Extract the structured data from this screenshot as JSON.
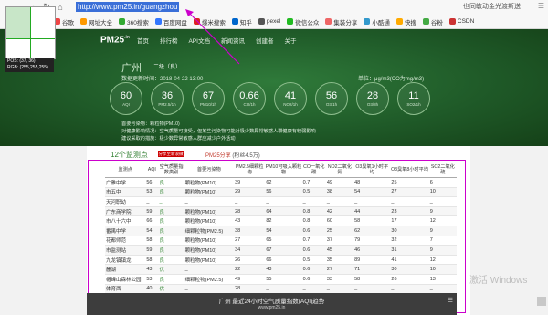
{
  "browser": {
    "url": "http://www.pm25.in/guangzhou",
    "toolbar_right": "也同敏动金光渡斯送",
    "bookmarks": [
      "谷歌",
      "网址大全",
      "360搜索",
      "百度网盘",
      "爆米搜索",
      "知乎",
      "pexel",
      "微信公众",
      "集装分享",
      "小酷通",
      "快搜",
      "谷粉",
      "CSDN"
    ]
  },
  "inspector": {
    "pos": "POS: (37, 36)",
    "rgb": "RGB: (255,255,255)"
  },
  "site": {
    "logo": "PM25",
    "logo_sup": ".in",
    "nav": [
      "首页",
      "排行榜",
      "API文档",
      "新闻资讯",
      "创建者",
      "关于"
    ]
  },
  "city": {
    "name": "广州",
    "level": "二级（良）",
    "updated": "数据更新时间：2018-04-22 13:00",
    "unit": "单位：μg/m3(CO为mg/m3)"
  },
  "metrics": [
    {
      "value": "60",
      "label": "AQI"
    },
    {
      "value": "36",
      "label": "PM2.5/1h"
    },
    {
      "value": "67",
      "label": "PM10/1h"
    },
    {
      "value": "0.66",
      "label": "CO/1h"
    },
    {
      "value": "41",
      "label": "NO2/1h"
    },
    {
      "value": "56",
      "label": "O3/1h"
    },
    {
      "value": "28",
      "label": "O3/8h"
    },
    {
      "value": "11",
      "label": "SO2/1h"
    }
  ],
  "info": {
    "primary": "首要污染物：颗粒物(PM10)",
    "health": "对健康影响情况：空气质量可接受，但某些污染物可能对极少数异常敏感人群健康有较弱影响",
    "advice": "建议采取的措施：极少数异常敏感人群应减少户外活动"
  },
  "monitor": {
    "title": "12个监测点",
    "button": "分享至新浪微博",
    "share_label": "PM25分享",
    "share_count": "(粉丝4.5万)"
  },
  "table": {
    "headers": [
      "监测点",
      "AQI",
      "空气质量指数类别",
      "首要污染物",
      "PM2.5细颗粒物",
      "PM10可吸入颗粒物",
      "CO一氧化碳",
      "NO2二氧化氮",
      "O3臭氧1小时平均",
      "O3臭氧8小时平均",
      "SO2二氧化硫"
    ],
    "rows": [
      [
        "广雅中学",
        "56",
        "良",
        "颗粒物(PM10)",
        "39",
        "62",
        "0.7",
        "49",
        "48",
        "25",
        "6"
      ],
      [
        "市五中",
        "53",
        "良",
        "颗粒物(PM10)",
        "29",
        "56",
        "0.5",
        "38",
        "54",
        "27",
        "10"
      ],
      [
        "天河职幼",
        "_",
        "_",
        "_",
        "_",
        "_",
        "_",
        "_",
        "_",
        "_",
        "_"
      ],
      [
        "广东商学院",
        "59",
        "良",
        "颗粒物(PM10)",
        "28",
        "64",
        "0.8",
        "42",
        "44",
        "23",
        "9"
      ],
      [
        "市八十六中",
        "66",
        "良",
        "颗粒物(PM10)",
        "43",
        "82",
        "0.8",
        "60",
        "58",
        "17",
        "12"
      ],
      [
        "番禺中学",
        "54",
        "良",
        "细颗粒物(PM2.5)",
        "38",
        "54",
        "0.6",
        "25",
        "62",
        "30",
        "9"
      ],
      [
        "花都师范",
        "58",
        "良",
        "颗粒物(PM10)",
        "27",
        "65",
        "0.7",
        "37",
        "79",
        "32",
        "7"
      ],
      [
        "市监测站",
        "59",
        "良",
        "颗粒物(PM10)",
        "34",
        "67",
        "0.6",
        "45",
        "46",
        "31",
        "9"
      ],
      [
        "九龙镇镇龙",
        "58",
        "良",
        "颗粒物(PM10)",
        "26",
        "66",
        "0.5",
        "35",
        "89",
        "41",
        "12"
      ],
      [
        "麓湖",
        "43",
        "优",
        "_",
        "22",
        "43",
        "0.6",
        "27",
        "71",
        "30",
        "10"
      ],
      [
        "帽峰山森林公园",
        "53",
        "良",
        "细颗粒物(PM2.5)",
        "49",
        "55",
        "0.6",
        "33",
        "58",
        "26",
        "13"
      ],
      [
        "体育西",
        "40",
        "优",
        "_",
        "28",
        "_",
        "_",
        "_",
        "_",
        "_",
        "_"
      ]
    ]
  },
  "banner": {
    "title": "广州 最近24小时空气质量指数(AQI)趋势",
    "subtitle": "www.pm25.in"
  },
  "watermark": "激活 Windows"
}
